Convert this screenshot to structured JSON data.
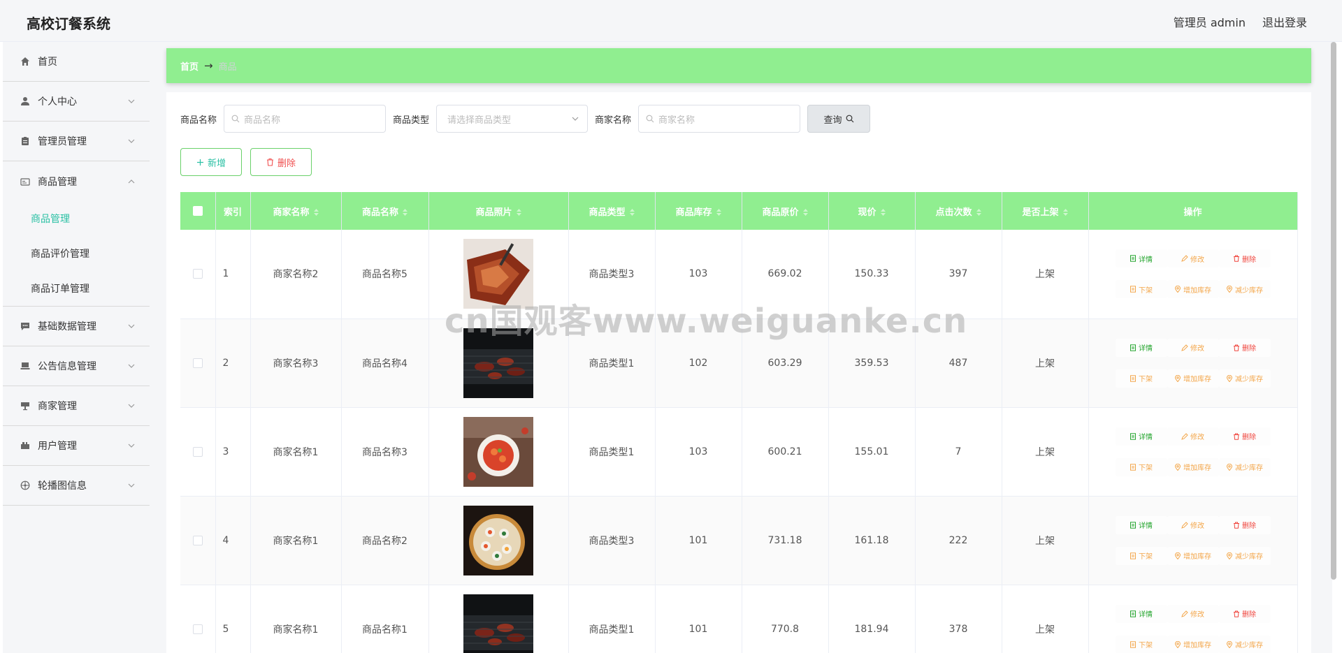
{
  "app": {
    "title": "高校订餐系统"
  },
  "header": {
    "user": "管理员 admin",
    "logout": "退出登录"
  },
  "sidebar": {
    "items": [
      {
        "label": "首页",
        "icon": "home-icon"
      },
      {
        "label": "个人中心",
        "icon": "user-icon"
      },
      {
        "label": "管理员管理",
        "icon": "clipboard-icon"
      },
      {
        "label": "商品管理",
        "icon": "card-icon"
      },
      {
        "label": "基础数据管理",
        "icon": "chat-icon"
      },
      {
        "label": "公告信息管理",
        "icon": "laptop-icon"
      },
      {
        "label": "商家管理",
        "icon": "shop-icon"
      },
      {
        "label": "用户管理",
        "icon": "truck-icon"
      },
      {
        "label": "轮播图信息",
        "icon": "compass-icon"
      }
    ],
    "sub_items": [
      "商品管理",
      "商品评价管理",
      "商品订单管理"
    ]
  },
  "breadcrumb": {
    "home": "首页",
    "sep": "→",
    "current": "商品"
  },
  "search": {
    "product_name_label": "商品名称",
    "product_name_placeholder": "商品名称",
    "product_type_label": "商品类型",
    "product_type_placeholder": "请选择商品类型",
    "merchant_name_label": "商家名称",
    "merchant_name_placeholder": "商家名称",
    "query_label": "查询"
  },
  "actions": {
    "add_label": "新增",
    "delete_label": "删除"
  },
  "table": {
    "columns": [
      "索引",
      "商家名称",
      "商品名称",
      "商品照片",
      "商品类型",
      "商品库存",
      "商品原价",
      "现价",
      "点击次数",
      "是否上架",
      "操作"
    ],
    "rows": [
      {
        "index": "1",
        "merchant": "商家名称2",
        "name": "商品名称5",
        "type": "商品类型3",
        "stock": "103",
        "orig_price": "669.02",
        "price": "150.33",
        "clicks": "397",
        "status": "上架"
      },
      {
        "index": "2",
        "merchant": "商家名称3",
        "name": "商品名称4",
        "type": "商品类型1",
        "stock": "102",
        "orig_price": "603.29",
        "price": "359.53",
        "clicks": "487",
        "status": "上架"
      },
      {
        "index": "3",
        "merchant": "商家名称1",
        "name": "商品名称3",
        "type": "商品类型1",
        "stock": "103",
        "orig_price": "600.21",
        "price": "155.01",
        "clicks": "7",
        "status": "上架"
      },
      {
        "index": "4",
        "merchant": "商家名称1",
        "name": "商品名称2",
        "type": "商品类型3",
        "stock": "101",
        "orig_price": "731.18",
        "price": "161.18",
        "clicks": "222",
        "status": "上架"
      },
      {
        "index": "5",
        "merchant": "商家名称1",
        "name": "商品名称1",
        "type": "商品类型1",
        "stock": "101",
        "orig_price": "770.8",
        "price": "181.94",
        "clicks": "378",
        "status": "上架"
      }
    ],
    "row_actions": {
      "detail": "详情",
      "edit": "修改",
      "delete": "删除",
      "off_shelf": "下架",
      "add_stock": "增加库存",
      "reduce_stock": "减少库存"
    }
  },
  "watermark": "cn国观客www.weiguanke.cn",
  "colors": {
    "accent": "#90ee90",
    "active": "#2bc0a4",
    "danger": "#f0463e",
    "warning": "#f3a64a",
    "success": "#21a42b"
  }
}
